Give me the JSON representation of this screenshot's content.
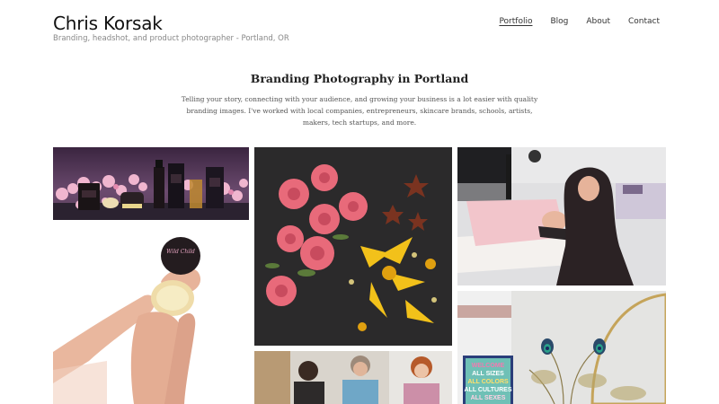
{
  "site": {
    "title": "Chris Korsak",
    "tagline": "Branding, headshot, and product photographer - Portland, OR"
  },
  "nav": {
    "items": [
      {
        "label": "Portfolio",
        "active": true
      },
      {
        "label": "Blog",
        "active": false
      },
      {
        "label": "About",
        "active": false
      },
      {
        "label": "Contact",
        "active": false
      }
    ]
  },
  "intro": {
    "title": "Branding Photography in Portland",
    "text": "Telling your story, connecting with your audience, and growing your business is a lot easier with quality branding images. I've worked with local companies, entrepreneurs, skincare brands, schools, artists, makers, tech startups, and more."
  },
  "gallery": {
    "product_label": "Wild Child",
    "welcome_sign": [
      "WELCOME",
      "ALL SIZES",
      "ALL COLORS",
      "ALL CULTURES",
      "ALL SEXES"
    ]
  },
  "colors": {
    "accent_pink": "#e9a6c3",
    "dark_bg": "#2a2a2a",
    "rose": "#e86a7a",
    "lily": "#f2c11a"
  }
}
